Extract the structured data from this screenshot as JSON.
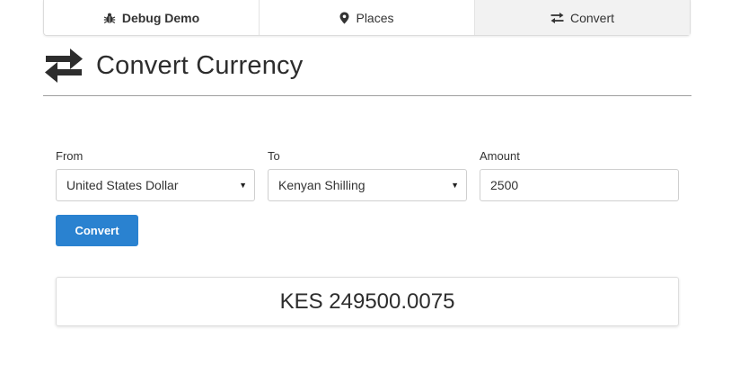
{
  "nav": {
    "tabs": [
      {
        "label": "Debug Demo",
        "icon": "bug-icon",
        "active": false
      },
      {
        "label": "Places",
        "icon": "map-marker-icon",
        "active": false
      },
      {
        "label": "Convert",
        "icon": "exchange-icon",
        "active": true
      }
    ]
  },
  "heading": {
    "title": "Convert Currency",
    "icon": "exchange-icon"
  },
  "form": {
    "from_label": "From",
    "from_value": "United States Dollar",
    "to_label": "To",
    "to_value": "Kenyan Shilling",
    "amount_label": "Amount",
    "amount_value": "2500",
    "convert_label": "Convert"
  },
  "result": {
    "text": "KES 249500.0075"
  },
  "colors": {
    "primary_button": "#2a82d0",
    "active_tab": "#f2f2f2"
  }
}
